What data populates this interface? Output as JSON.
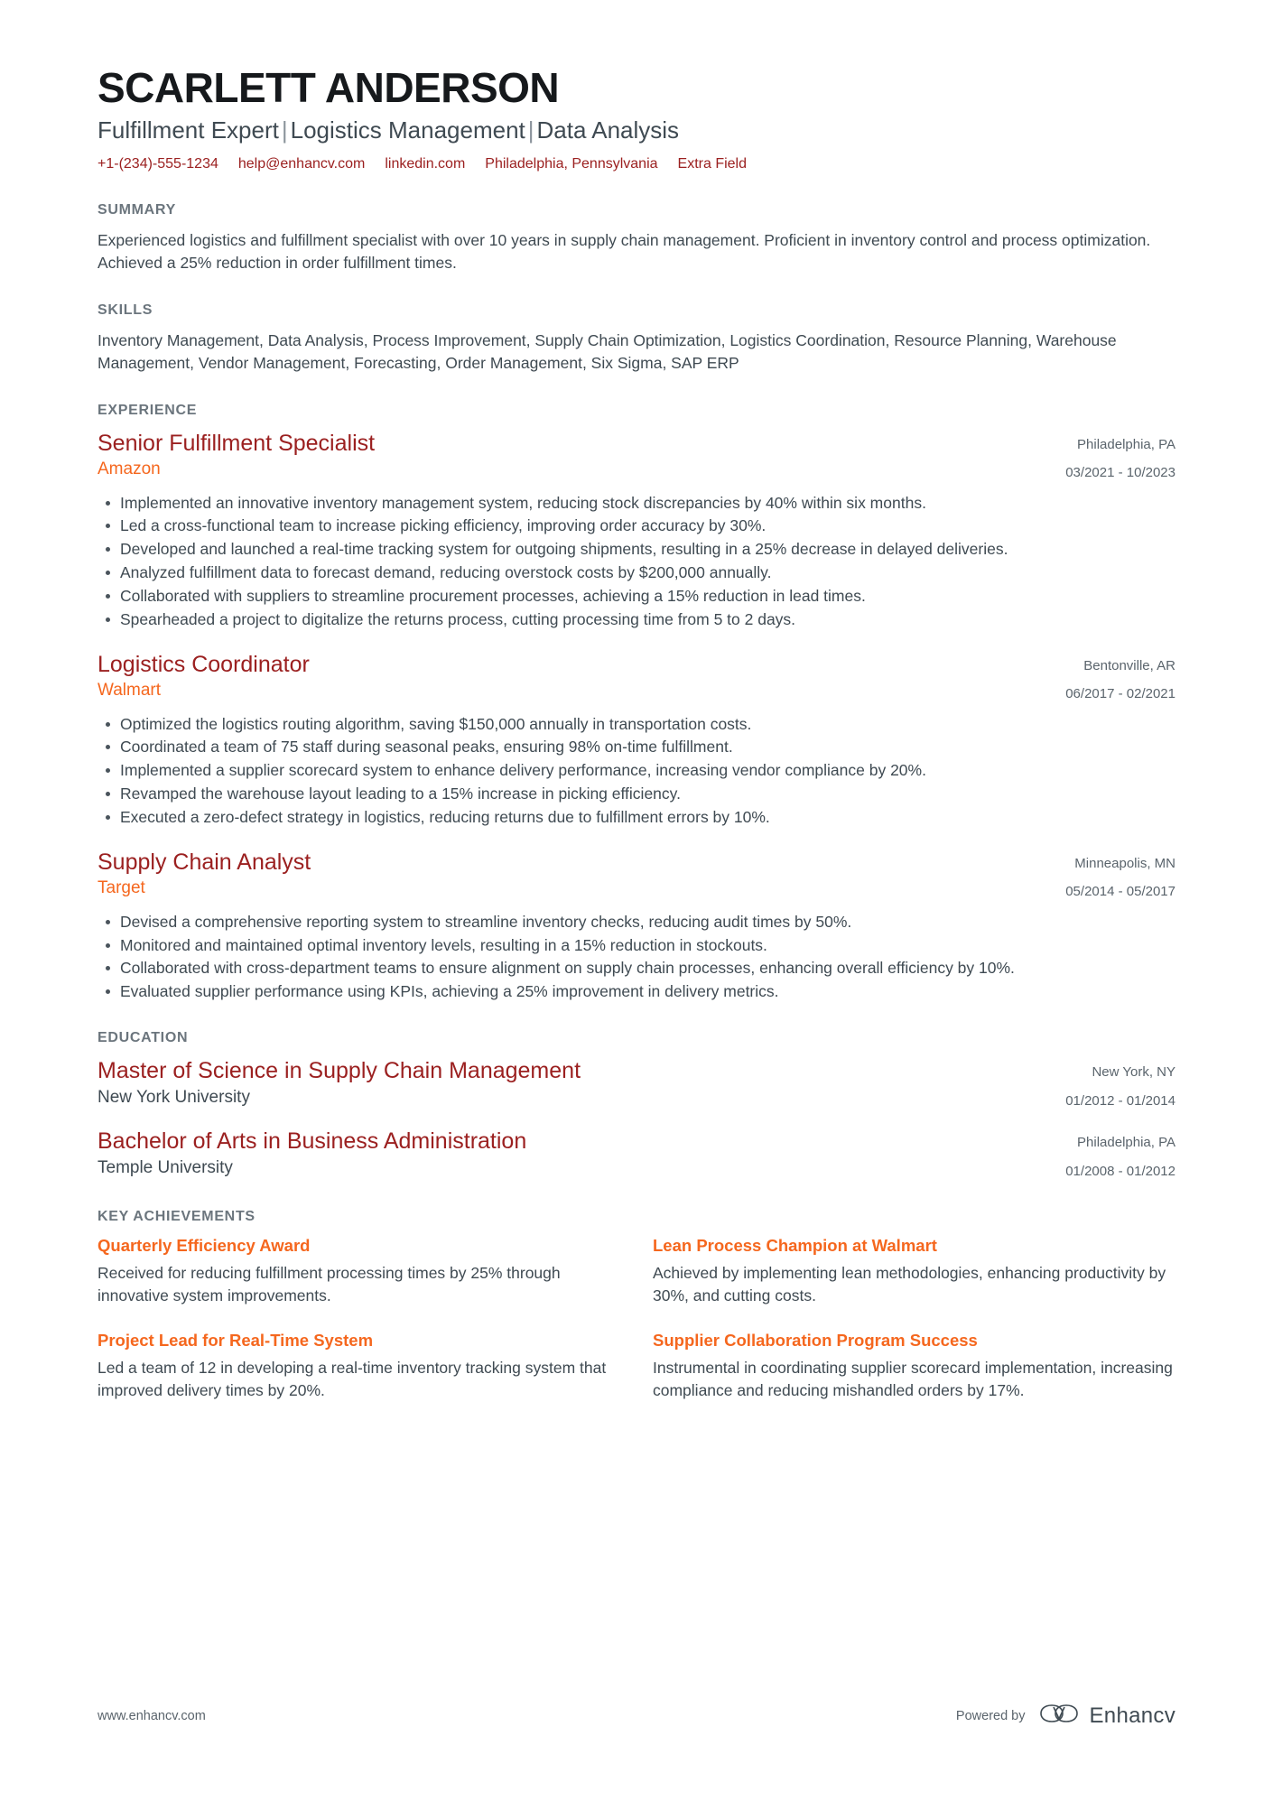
{
  "header": {
    "name": "SCARLETT ANDERSON",
    "headline_parts": [
      "Fulfillment Expert",
      "Logistics Management",
      "Data Analysis"
    ],
    "headline_separator": "|",
    "contacts": [
      {
        "name": "phone",
        "value": "+1-(234)-555-1234"
      },
      {
        "name": "email",
        "value": "help@enhancv.com"
      },
      {
        "name": "linkedin",
        "value": "linkedin.com"
      },
      {
        "name": "location",
        "value": "Philadelphia, Pennsylvania"
      },
      {
        "name": "extra",
        "value": "Extra Field"
      }
    ],
    "accent_contact_color": "#9B2020"
  },
  "summary": {
    "title": "SUMMARY",
    "text": "Experienced logistics and fulfillment specialist with over 10 years in supply chain management. Proficient in inventory control and process optimization. Achieved a 25% reduction in order fulfillment times."
  },
  "skills": {
    "title": "SKILLS",
    "text": "Inventory Management, Data Analysis, Process Improvement, Supply Chain Optimization, Logistics Coordination, Resource Planning, Warehouse Management, Vendor Management, Forecasting, Order Management, Six Sigma, SAP ERP"
  },
  "experience": {
    "title": "EXPERIENCE",
    "entries": [
      {
        "role": "Senior Fulfillment Specialist",
        "company": "Amazon",
        "location": "Philadelphia, PA",
        "dates": "03/2021 - 10/2023",
        "bullets": [
          "Implemented an innovative inventory management system, reducing stock discrepancies by 40% within six months.",
          "Led a cross-functional team to increase picking efficiency, improving order accuracy by 30%.",
          "Developed and launched a real-time tracking system for outgoing shipments, resulting in a 25% decrease in delayed deliveries.",
          "Analyzed fulfillment data to forecast demand, reducing overstock costs by $200,000 annually.",
          "Collaborated with suppliers to streamline procurement processes, achieving a 15% reduction in lead times.",
          "Spearheaded a project to digitalize the returns process, cutting processing time from 5 to 2 days."
        ]
      },
      {
        "role": "Logistics Coordinator",
        "company": "Walmart",
        "location": "Bentonville, AR",
        "dates": "06/2017 - 02/2021",
        "bullets": [
          "Optimized the logistics routing algorithm, saving $150,000 annually in transportation costs.",
          "Coordinated a team of 75 staff during seasonal peaks, ensuring 98% on-time fulfillment.",
          "Implemented a supplier scorecard system to enhance delivery performance, increasing vendor compliance by 20%.",
          "Revamped the warehouse layout leading to a 15% increase in picking efficiency.",
          "Executed a zero-defect strategy in logistics, reducing returns due to fulfillment errors by 10%."
        ]
      },
      {
        "role": "Supply Chain Analyst",
        "company": "Target",
        "location": "Minneapolis, MN",
        "dates": "05/2014 - 05/2017",
        "bullets": [
          "Devised a comprehensive reporting system to streamline inventory checks, reducing audit times by 50%.",
          "Monitored and maintained optimal inventory levels, resulting in a 15% reduction in stockouts.",
          "Collaborated with cross-department teams to ensure alignment on supply chain processes, enhancing overall efficiency by 10%.",
          "Evaluated supplier performance using KPIs, achieving a 25% improvement in delivery metrics."
        ]
      }
    ]
  },
  "education": {
    "title": "EDUCATION",
    "entries": [
      {
        "degree": "Master of Science in Supply Chain Management",
        "school": "New York University",
        "location": "New York, NY",
        "dates": "01/2012 - 01/2014"
      },
      {
        "degree": "Bachelor of Arts in Business Administration",
        "school": "Temple University",
        "location": "Philadelphia, PA",
        "dates": "01/2008 - 01/2012"
      }
    ]
  },
  "key_achievements": {
    "title": "KEY ACHIEVEMENTS",
    "items": [
      {
        "title": "Quarterly Efficiency Award",
        "description": "Received for reducing fulfillment processing times by 25% through innovative system improvements."
      },
      {
        "title": "Lean Process Champion at Walmart",
        "description": "Achieved by implementing lean methodologies, enhancing productivity by 30%, and cutting costs."
      },
      {
        "title": "Project Lead for Real-Time System",
        "description": "Led a team of 12 in developing a real-time inventory tracking system that improved delivery times by 20%."
      },
      {
        "title": "Supplier Collaboration Program Success",
        "description": "Instrumental in coordinating supplier scorecard implementation, increasing compliance and reducing mishandled orders by 17%."
      }
    ]
  },
  "footer": {
    "website": "www.enhancv.com",
    "powered_by": "Powered by",
    "brand_name": "Enhancv"
  },
  "colors": {
    "title_red": "#9B2020",
    "company_orange": "#F5671E",
    "section_heading_gray": "#6B757D",
    "body_gray": "#3F4A52"
  }
}
